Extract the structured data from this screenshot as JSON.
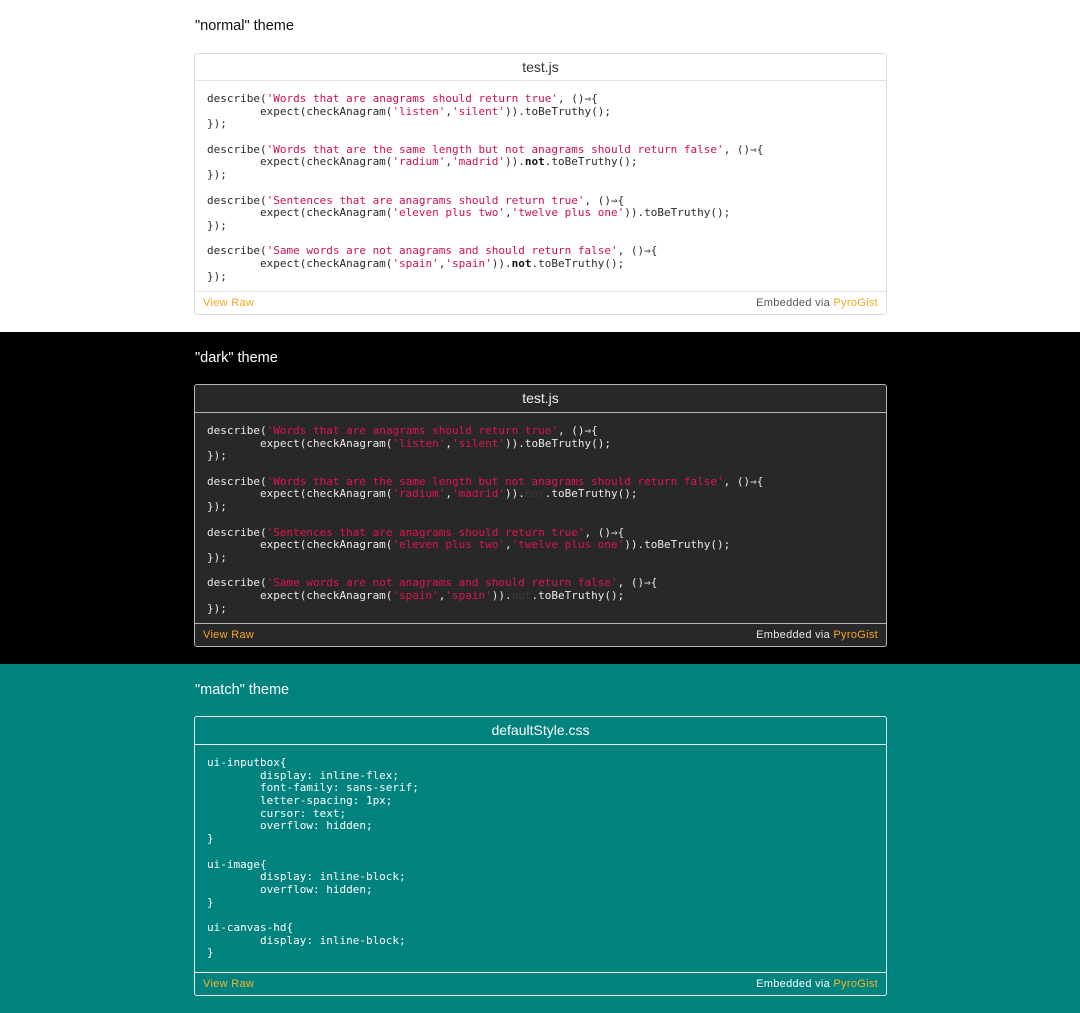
{
  "sections": [
    {
      "label": "\"normal\" theme",
      "file": "test.js",
      "view_raw": "View Raw",
      "embedded_prefix": "Embedded via ",
      "embedded_link": "PyroGist",
      "lines": [
        [
          {
            "t": "describe("
          },
          {
            "t": "'Words that are anagrams should return true'",
            "c": "str"
          },
          {
            "t": ", ()⇒{"
          }
        ],
        [
          {
            "t": "        expect(checkAnagram("
          },
          {
            "t": "'listen'",
            "c": "str"
          },
          {
            "t": ","
          },
          {
            "t": "'silent'",
            "c": "str"
          },
          {
            "t": ")).toBeTruthy();"
          }
        ],
        [
          {
            "t": "});"
          }
        ],
        [],
        [
          {
            "t": "describe("
          },
          {
            "t": "'Words that are the same length but not anagrams should return false'",
            "c": "str"
          },
          {
            "t": ", ()⇒{"
          }
        ],
        [
          {
            "t": "        expect(checkAnagram("
          },
          {
            "t": "'radium'",
            "c": "str"
          },
          {
            "t": ","
          },
          {
            "t": "'madrid'",
            "c": "str"
          },
          {
            "t": "))."
          },
          {
            "t": "not",
            "c": "kw"
          },
          {
            "t": ".toBeTruthy();"
          }
        ],
        [
          {
            "t": "});"
          }
        ],
        [],
        [
          {
            "t": "describe("
          },
          {
            "t": "'Sentences that are anagrams should return true'",
            "c": "str"
          },
          {
            "t": ", ()⇒{"
          }
        ],
        [
          {
            "t": "        expect(checkAnagram("
          },
          {
            "t": "'eleven plus two'",
            "c": "str"
          },
          {
            "t": ","
          },
          {
            "t": "'twelve plus one'",
            "c": "str"
          },
          {
            "t": ")).toBeTruthy();"
          }
        ],
        [
          {
            "t": "});"
          }
        ],
        [],
        [
          {
            "t": "describe("
          },
          {
            "t": "'Same words are not anagrams and should return false'",
            "c": "str"
          },
          {
            "t": ", ()⇒{"
          }
        ],
        [
          {
            "t": "        expect(checkAnagram("
          },
          {
            "t": "'spain'",
            "c": "str"
          },
          {
            "t": ","
          },
          {
            "t": "'spain'",
            "c": "str"
          },
          {
            "t": "))."
          },
          {
            "t": "not",
            "c": "kw"
          },
          {
            "t": ".toBeTruthy();"
          }
        ],
        [
          {
            "t": "});"
          }
        ]
      ]
    },
    {
      "label": "\"dark\" theme",
      "file": "test.js",
      "view_raw": "View Raw",
      "embedded_prefix": "Embedded via ",
      "embedded_link": "PyroGist",
      "lines": [
        [
          {
            "t": "describe("
          },
          {
            "t": "'Words that are anagrams should return true'",
            "c": "str"
          },
          {
            "t": ", ()⇒{"
          }
        ],
        [
          {
            "t": "        expect(checkAnagram("
          },
          {
            "t": "'listen'",
            "c": "str"
          },
          {
            "t": ","
          },
          {
            "t": "'silent'",
            "c": "str"
          },
          {
            "t": ")).toBeTruthy();"
          }
        ],
        [
          {
            "t": "});"
          }
        ],
        [],
        [
          {
            "t": "describe("
          },
          {
            "t": "'Words that are the same length but not anagrams should return false'",
            "c": "str"
          },
          {
            "t": ", ()⇒{"
          }
        ],
        [
          {
            "t": "        expect(checkAnagram("
          },
          {
            "t": "'radium'",
            "c": "str"
          },
          {
            "t": ","
          },
          {
            "t": "'madrid'",
            "c": "str"
          },
          {
            "t": "))."
          },
          {
            "t": "not",
            "c": "kw"
          },
          {
            "t": ".toBeTruthy();"
          }
        ],
        [
          {
            "t": "});"
          }
        ],
        [],
        [
          {
            "t": "describe("
          },
          {
            "t": "'Sentences that are anagrams should return true'",
            "c": "str"
          },
          {
            "t": ", ()⇒{"
          }
        ],
        [
          {
            "t": "        expect(checkAnagram("
          },
          {
            "t": "'eleven plus two'",
            "c": "str"
          },
          {
            "t": ","
          },
          {
            "t": "'twelve plus one'",
            "c": "str"
          },
          {
            "t": ")).toBeTruthy();"
          }
        ],
        [
          {
            "t": "});"
          }
        ],
        [],
        [
          {
            "t": "describe("
          },
          {
            "t": "'Same words are not anagrams and should return false'",
            "c": "str"
          },
          {
            "t": ", ()⇒{"
          }
        ],
        [
          {
            "t": "        expect(checkAnagram("
          },
          {
            "t": "'spain'",
            "c": "str"
          },
          {
            "t": ","
          },
          {
            "t": "'spain'",
            "c": "str"
          },
          {
            "t": "))."
          },
          {
            "t": "not",
            "c": "kw"
          },
          {
            "t": ".toBeTruthy();"
          }
        ],
        [
          {
            "t": "});"
          }
        ]
      ]
    },
    {
      "label": "\"match\" theme",
      "file": "defaultStyle.css",
      "view_raw": "View Raw",
      "embedded_prefix": "Embedded via ",
      "embedded_link": "PyroGist",
      "lines": [
        [
          {
            "t": "ui-inputbox{"
          }
        ],
        [
          {
            "t": "        display: inline-flex;"
          }
        ],
        [
          {
            "t": "        font-family: sans-serif;"
          }
        ],
        [
          {
            "t": "        letter-spacing: 1px;"
          }
        ],
        [
          {
            "t": "        cursor: text;"
          }
        ],
        [
          {
            "t": "        overflow: hidden;"
          }
        ],
        [
          {
            "t": "}"
          }
        ],
        [],
        [
          {
            "t": "ui-image{"
          }
        ],
        [
          {
            "t": "        display: inline-block;"
          }
        ],
        [
          {
            "t": "        overflow: hidden;"
          }
        ],
        [
          {
            "t": "}"
          }
        ],
        [],
        [
          {
            "t": "ui-canvas-hd{"
          }
        ],
        [
          {
            "t": "        display: inline-block;"
          }
        ],
        [
          {
            "t": "}"
          }
        ]
      ]
    }
  ],
  "colors": {
    "normal_bg": "#ffffff",
    "dark_bg": "#000000",
    "match_bg": "#00827e",
    "string": "#d1104a",
    "link": "#f5a623"
  }
}
